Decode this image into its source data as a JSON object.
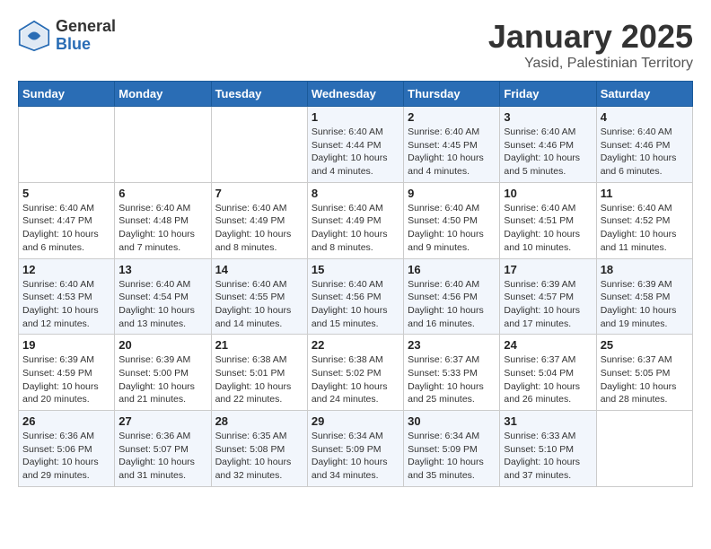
{
  "logo": {
    "general": "General",
    "blue": "Blue"
  },
  "title": "January 2025",
  "subtitle": "Yasid, Palestinian Territory",
  "days_of_week": [
    "Sunday",
    "Monday",
    "Tuesday",
    "Wednesday",
    "Thursday",
    "Friday",
    "Saturday"
  ],
  "weeks": [
    [
      {
        "day": "",
        "info": ""
      },
      {
        "day": "",
        "info": ""
      },
      {
        "day": "",
        "info": ""
      },
      {
        "day": "1",
        "info": "Sunrise: 6:40 AM\nSunset: 4:44 PM\nDaylight: 10 hours\nand 4 minutes."
      },
      {
        "day": "2",
        "info": "Sunrise: 6:40 AM\nSunset: 4:45 PM\nDaylight: 10 hours\nand 4 minutes."
      },
      {
        "day": "3",
        "info": "Sunrise: 6:40 AM\nSunset: 4:46 PM\nDaylight: 10 hours\nand 5 minutes."
      },
      {
        "day": "4",
        "info": "Sunrise: 6:40 AM\nSunset: 4:46 PM\nDaylight: 10 hours\nand 6 minutes."
      }
    ],
    [
      {
        "day": "5",
        "info": "Sunrise: 6:40 AM\nSunset: 4:47 PM\nDaylight: 10 hours\nand 6 minutes."
      },
      {
        "day": "6",
        "info": "Sunrise: 6:40 AM\nSunset: 4:48 PM\nDaylight: 10 hours\nand 7 minutes."
      },
      {
        "day": "7",
        "info": "Sunrise: 6:40 AM\nSunset: 4:49 PM\nDaylight: 10 hours\nand 8 minutes."
      },
      {
        "day": "8",
        "info": "Sunrise: 6:40 AM\nSunset: 4:49 PM\nDaylight: 10 hours\nand 8 minutes."
      },
      {
        "day": "9",
        "info": "Sunrise: 6:40 AM\nSunset: 4:50 PM\nDaylight: 10 hours\nand 9 minutes."
      },
      {
        "day": "10",
        "info": "Sunrise: 6:40 AM\nSunset: 4:51 PM\nDaylight: 10 hours\nand 10 minutes."
      },
      {
        "day": "11",
        "info": "Sunrise: 6:40 AM\nSunset: 4:52 PM\nDaylight: 10 hours\nand 11 minutes."
      }
    ],
    [
      {
        "day": "12",
        "info": "Sunrise: 6:40 AM\nSunset: 4:53 PM\nDaylight: 10 hours\nand 12 minutes."
      },
      {
        "day": "13",
        "info": "Sunrise: 6:40 AM\nSunset: 4:54 PM\nDaylight: 10 hours\nand 13 minutes."
      },
      {
        "day": "14",
        "info": "Sunrise: 6:40 AM\nSunset: 4:55 PM\nDaylight: 10 hours\nand 14 minutes."
      },
      {
        "day": "15",
        "info": "Sunrise: 6:40 AM\nSunset: 4:56 PM\nDaylight: 10 hours\nand 15 minutes."
      },
      {
        "day": "16",
        "info": "Sunrise: 6:40 AM\nSunset: 4:56 PM\nDaylight: 10 hours\nand 16 minutes."
      },
      {
        "day": "17",
        "info": "Sunrise: 6:39 AM\nSunset: 4:57 PM\nDaylight: 10 hours\nand 17 minutes."
      },
      {
        "day": "18",
        "info": "Sunrise: 6:39 AM\nSunset: 4:58 PM\nDaylight: 10 hours\nand 19 minutes."
      }
    ],
    [
      {
        "day": "19",
        "info": "Sunrise: 6:39 AM\nSunset: 4:59 PM\nDaylight: 10 hours\nand 20 minutes."
      },
      {
        "day": "20",
        "info": "Sunrise: 6:39 AM\nSunset: 5:00 PM\nDaylight: 10 hours\nand 21 minutes."
      },
      {
        "day": "21",
        "info": "Sunrise: 6:38 AM\nSunset: 5:01 PM\nDaylight: 10 hours\nand 22 minutes."
      },
      {
        "day": "22",
        "info": "Sunrise: 6:38 AM\nSunset: 5:02 PM\nDaylight: 10 hours\nand 24 minutes."
      },
      {
        "day": "23",
        "info": "Sunrise: 6:37 AM\nSunset: 5:33 PM\nDaylight: 10 hours\nand 25 minutes."
      },
      {
        "day": "24",
        "info": "Sunrise: 6:37 AM\nSunset: 5:04 PM\nDaylight: 10 hours\nand 26 minutes."
      },
      {
        "day": "25",
        "info": "Sunrise: 6:37 AM\nSunset: 5:05 PM\nDaylight: 10 hours\nand 28 minutes."
      }
    ],
    [
      {
        "day": "26",
        "info": "Sunrise: 6:36 AM\nSunset: 5:06 PM\nDaylight: 10 hours\nand 29 minutes."
      },
      {
        "day": "27",
        "info": "Sunrise: 6:36 AM\nSunset: 5:07 PM\nDaylight: 10 hours\nand 31 minutes."
      },
      {
        "day": "28",
        "info": "Sunrise: 6:35 AM\nSunset: 5:08 PM\nDaylight: 10 hours\nand 32 minutes."
      },
      {
        "day": "29",
        "info": "Sunrise: 6:34 AM\nSunset: 5:09 PM\nDaylight: 10 hours\nand 34 minutes."
      },
      {
        "day": "30",
        "info": "Sunrise: 6:34 AM\nSunset: 5:09 PM\nDaylight: 10 hours\nand 35 minutes."
      },
      {
        "day": "31",
        "info": "Sunrise: 6:33 AM\nSunset: 5:10 PM\nDaylight: 10 hours\nand 37 minutes."
      },
      {
        "day": "",
        "info": ""
      }
    ]
  ]
}
